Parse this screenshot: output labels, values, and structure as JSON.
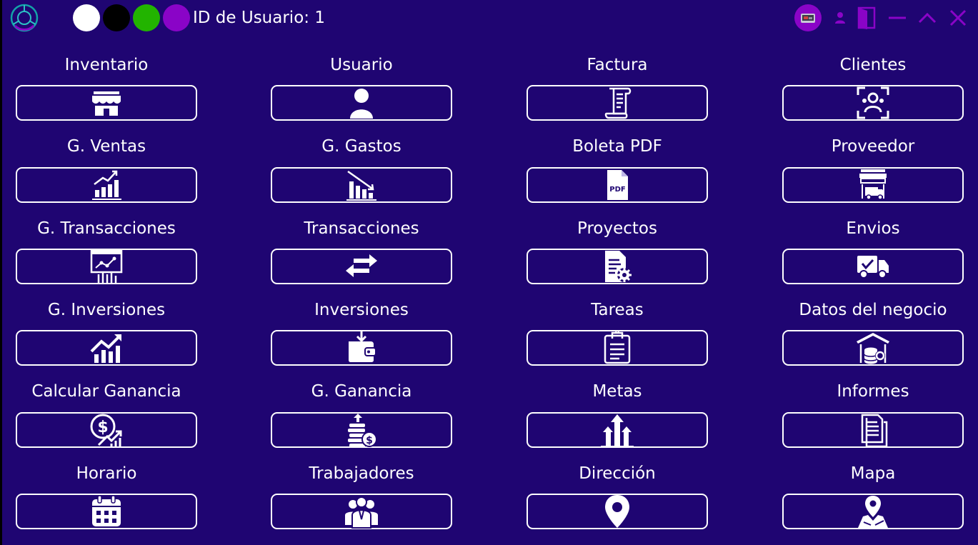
{
  "header": {
    "user_id_text": "ID de Usuario: 1",
    "theme_colors": [
      "#ffffff",
      "#000000",
      "#22b400",
      "#8a04c7"
    ],
    "window_controls": [
      "profile-photo-icon",
      "user-icon",
      "logout-door-icon",
      "minimize-icon",
      "maximize-icon",
      "close-icon"
    ]
  },
  "colors": {
    "background": "#1f0572",
    "accent": "#8a04c7",
    "foreground": "#ffffff"
  },
  "grid": [
    {
      "label": "Inventario",
      "icon": "store-icon"
    },
    {
      "label": "Usuario",
      "icon": "user-icon"
    },
    {
      "label": "Factura",
      "icon": "invoice-scroll-icon"
    },
    {
      "label": "Clientes",
      "icon": "clients-scan-icon"
    },
    {
      "label": "G. Ventas",
      "icon": "sales-chart-icon"
    },
    {
      "label": "G. Gastos",
      "icon": "expenses-chart-icon"
    },
    {
      "label": "Boleta PDF",
      "icon": "pdf-file-icon"
    },
    {
      "label": "Proveedor",
      "icon": "supplier-truck-icon"
    },
    {
      "label": "G. Transacciones",
      "icon": "transactions-board-icon"
    },
    {
      "label": "Transacciones",
      "icon": "transfer-arrows-icon"
    },
    {
      "label": "Proyectos",
      "icon": "project-doc-gear-icon"
    },
    {
      "label": "Envios",
      "icon": "delivery-truck-icon"
    },
    {
      "label": "G. Inversiones",
      "icon": "investment-growth-icon"
    },
    {
      "label": "Inversiones",
      "icon": "wallet-icon"
    },
    {
      "label": "Tareas",
      "icon": "clipboard-icon"
    },
    {
      "label": "Datos del negocio",
      "icon": "business-data-icon"
    },
    {
      "label": "Calcular Ganancia",
      "icon": "profit-calc-icon"
    },
    {
      "label": "G. Ganancia",
      "icon": "coins-stack-icon"
    },
    {
      "label": "Metas",
      "icon": "goals-arrows-icon"
    },
    {
      "label": "Informes",
      "icon": "reports-icon"
    },
    {
      "label": "Horario",
      "icon": "calendar-icon"
    },
    {
      "label": "Trabajadores",
      "icon": "workers-group-icon"
    },
    {
      "label": "Dirección",
      "icon": "location-pin-icon"
    },
    {
      "label": "Mapa",
      "icon": "map-pin-icon"
    }
  ]
}
